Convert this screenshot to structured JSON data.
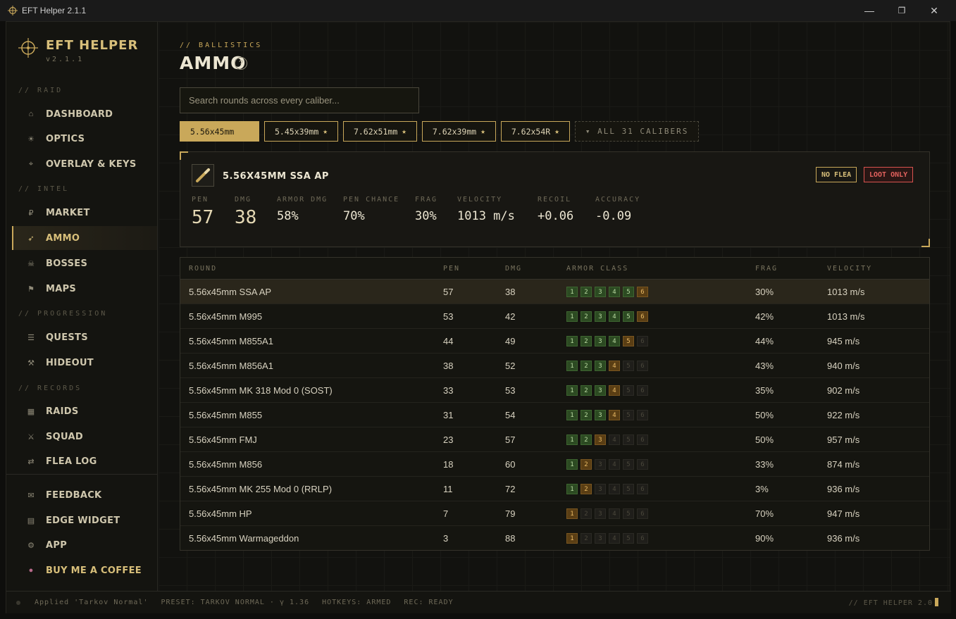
{
  "window": {
    "title": "EFT Helper 2.1.1",
    "controls": {
      "minimize": "—",
      "restore": "❐",
      "close": "✕"
    }
  },
  "brand": {
    "name": "EFT HELPER",
    "version": "v2.1.1"
  },
  "sidebar": {
    "sections": [
      {
        "label": "// RAID",
        "items": [
          {
            "label": "DASHBOARD",
            "icon": "home-icon",
            "glyph": "⌂"
          },
          {
            "label": "OPTICS",
            "icon": "sun-icon",
            "glyph": "☀"
          },
          {
            "label": "OVERLAY & KEYS",
            "icon": "diamond-icon",
            "glyph": "⌖"
          }
        ]
      },
      {
        "label": "// INTEL",
        "items": [
          {
            "label": "MARKET",
            "icon": "ruble-icon",
            "glyph": "₽"
          },
          {
            "label": "AMMO",
            "icon": "bullet-icon",
            "glyph": "➶",
            "active": true
          },
          {
            "label": "BOSSES",
            "icon": "skull-icon",
            "glyph": "☠"
          },
          {
            "label": "MAPS",
            "icon": "flag-icon",
            "glyph": "⚑"
          }
        ]
      },
      {
        "label": "// PROGRESSION",
        "items": [
          {
            "label": "QUESTS",
            "icon": "list-icon",
            "glyph": "☰"
          },
          {
            "label": "HIDEOUT",
            "icon": "tools-icon",
            "glyph": "⚒"
          }
        ]
      },
      {
        "label": "// RECORDS",
        "items": [
          {
            "label": "RAIDS",
            "icon": "grid-icon",
            "glyph": "▦"
          },
          {
            "label": "SQUAD",
            "icon": "swords-icon",
            "glyph": "⚔"
          },
          {
            "label": "FLEA LOG",
            "icon": "swap-icon",
            "glyph": "⇄"
          }
        ]
      }
    ],
    "footer": [
      {
        "label": "FEEDBACK",
        "icon": "mail-icon",
        "glyph": "✉"
      },
      {
        "label": "EDGE WIDGET",
        "icon": "widget-icon",
        "glyph": "▤"
      },
      {
        "label": "APP",
        "icon": "gear-icon",
        "glyph": "⚙"
      },
      {
        "label": "BUY ME A COFFEE",
        "icon": "coffee-icon",
        "glyph": "●"
      }
    ]
  },
  "main": {
    "breadcrumb": "// BALLISTICS",
    "title": "AMMO",
    "help": "?",
    "search_placeholder": "Search rounds across every caliber...",
    "calibers": [
      {
        "label": "5.56x45mm",
        "active": true,
        "starred": false
      },
      {
        "label": "5.45x39mm",
        "starred": true
      },
      {
        "label": "7.62x51mm",
        "starred": true
      },
      {
        "label": "7.62x39mm",
        "starred": true
      },
      {
        "label": "7.62x54R",
        "starred": true
      }
    ],
    "all_calibers": "▾ ALL 31 CALIBERS",
    "detail": {
      "name": "5.56X45MM SSA AP",
      "tags": [
        {
          "label": "NO FLEA",
          "color": "#c9a85a"
        },
        {
          "label": "LOOT ONLY",
          "color": "#d9534f"
        }
      ],
      "stats": [
        {
          "label": "PEN",
          "value": "57"
        },
        {
          "label": "DMG",
          "value": "38"
        },
        {
          "label": "ARMOR DMG",
          "value": "58%"
        },
        {
          "label": "PEN CHANCE",
          "value": "70%"
        },
        {
          "label": "FRAG",
          "value": "30%"
        },
        {
          "label": "VELOCITY",
          "value": "1013 m/s"
        },
        {
          "label": "RECOIL",
          "value": "+0.06"
        },
        {
          "label": "ACCURACY",
          "value": "-0.09"
        }
      ]
    },
    "table": {
      "headers": [
        "ROUND",
        "PEN",
        "DMG",
        "ARMOR CLASS",
        "FRAG",
        "VELOCITY"
      ],
      "rows": [
        {
          "round": "5.56x45mm SSA AP",
          "pen": "57",
          "dmg": "38",
          "armor": "gggggo",
          "frag": "30%",
          "velocity": "1013 m/s",
          "selected": true
        },
        {
          "round": "5.56x45mm M995",
          "pen": "53",
          "dmg": "42",
          "armor": "gggggo",
          "frag": "42%",
          "velocity": "1013 m/s"
        },
        {
          "round": "5.56x45mm M855A1",
          "pen": "44",
          "dmg": "49",
          "armor": "ggggon",
          "frag": "44%",
          "velocity": "945 m/s"
        },
        {
          "round": "5.56x45mm M856A1",
          "pen": "38",
          "dmg": "52",
          "armor": "gggonn",
          "frag": "43%",
          "velocity": "940 m/s"
        },
        {
          "round": "5.56x45mm MK 318 Mod 0 (SOST)",
          "pen": "33",
          "dmg": "53",
          "armor": "gggonn",
          "frag": "35%",
          "velocity": "902 m/s"
        },
        {
          "round": "5.56x45mm M855",
          "pen": "31",
          "dmg": "54",
          "armor": "gggonn",
          "frag": "50%",
          "velocity": "922 m/s"
        },
        {
          "round": "5.56x45mm FMJ",
          "pen": "23",
          "dmg": "57",
          "armor": "ggonnn",
          "frag": "50%",
          "velocity": "957 m/s"
        },
        {
          "round": "5.56x45mm M856",
          "pen": "18",
          "dmg": "60",
          "armor": "gonnnn",
          "frag": "33%",
          "velocity": "874 m/s"
        },
        {
          "round": "5.56x45mm MK 255 Mod 0 (RRLP)",
          "pen": "11",
          "dmg": "72",
          "armor": "gonnnn",
          "frag": "3%",
          "velocity": "936 m/s"
        },
        {
          "round": "5.56x45mm HP",
          "pen": "7",
          "dmg": "79",
          "armor": "onnnnn",
          "frag": "70%",
          "velocity": "947 m/s"
        },
        {
          "round": "5.56x45mm Warmageddon",
          "pen": "3",
          "dmg": "88",
          "armor": "onnnnn",
          "frag": "90%",
          "velocity": "936 m/s"
        }
      ]
    }
  },
  "status": {
    "applied": "Applied 'Tarkov Normal'",
    "preset": "PRESET: TARKOV NORMAL · γ 1.36",
    "hotkeys": "HOTKEYS: ARMED",
    "rec": "REC: READY",
    "right": "// EFT HELPER 2.0"
  }
}
